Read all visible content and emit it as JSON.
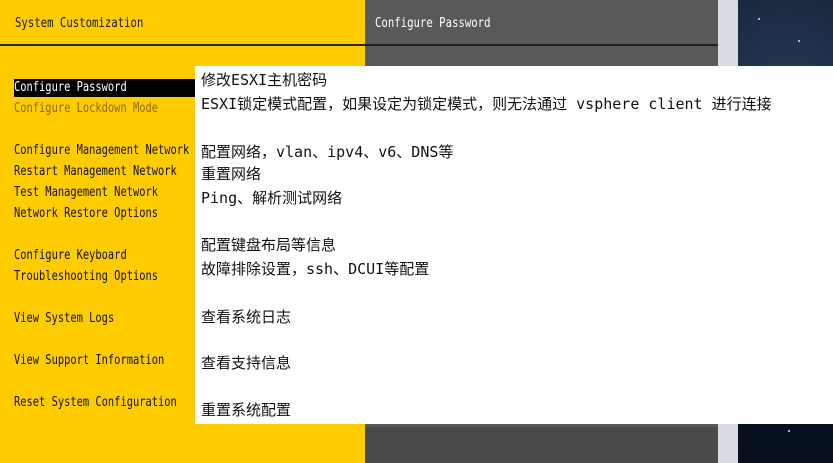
{
  "left_panel": {
    "title": "System Customization",
    "menu_items": [
      {
        "label": "Configure Password"
      },
      {
        "label": "Configure Lockdown Mode"
      },
      {
        "label": "Configure Management Network"
      },
      {
        "label": "Restart Management Network"
      },
      {
        "label": "Test Management Network"
      },
      {
        "label": "Network Restore Options"
      },
      {
        "label": "Configure Keyboard"
      },
      {
        "label": "Troubleshooting Options"
      },
      {
        "label": "View System Logs"
      },
      {
        "label": "View Support Information"
      },
      {
        "label": "Reset System Configuration"
      }
    ],
    "selected_index": 0
  },
  "right_panel": {
    "title": "Configure Password"
  },
  "annotations": [
    {
      "text": "修改ESXI主机密码"
    },
    {
      "text": "ESXI锁定模式配置，如果设定为锁定模式，则无法通过 vsphere client 进行连接"
    },
    {
      "text": "配置网络，vlan、ipv4、v6、DNS等"
    },
    {
      "text": "重置网络"
    },
    {
      "text": "Ping、解析测试网络"
    },
    {
      "text": "配置键盘布局等信息"
    },
    {
      "text": "故障排除设置，ssh、DCUI等配置"
    },
    {
      "text": "查看系统日志"
    },
    {
      "text": "查看支持信息"
    },
    {
      "text": "重置系统配置"
    }
  ],
  "colors": {
    "menu_background": "#ffcc00",
    "detail_background": "#595959",
    "selection_background": "#000000",
    "annotation_background": "#ffffff"
  }
}
